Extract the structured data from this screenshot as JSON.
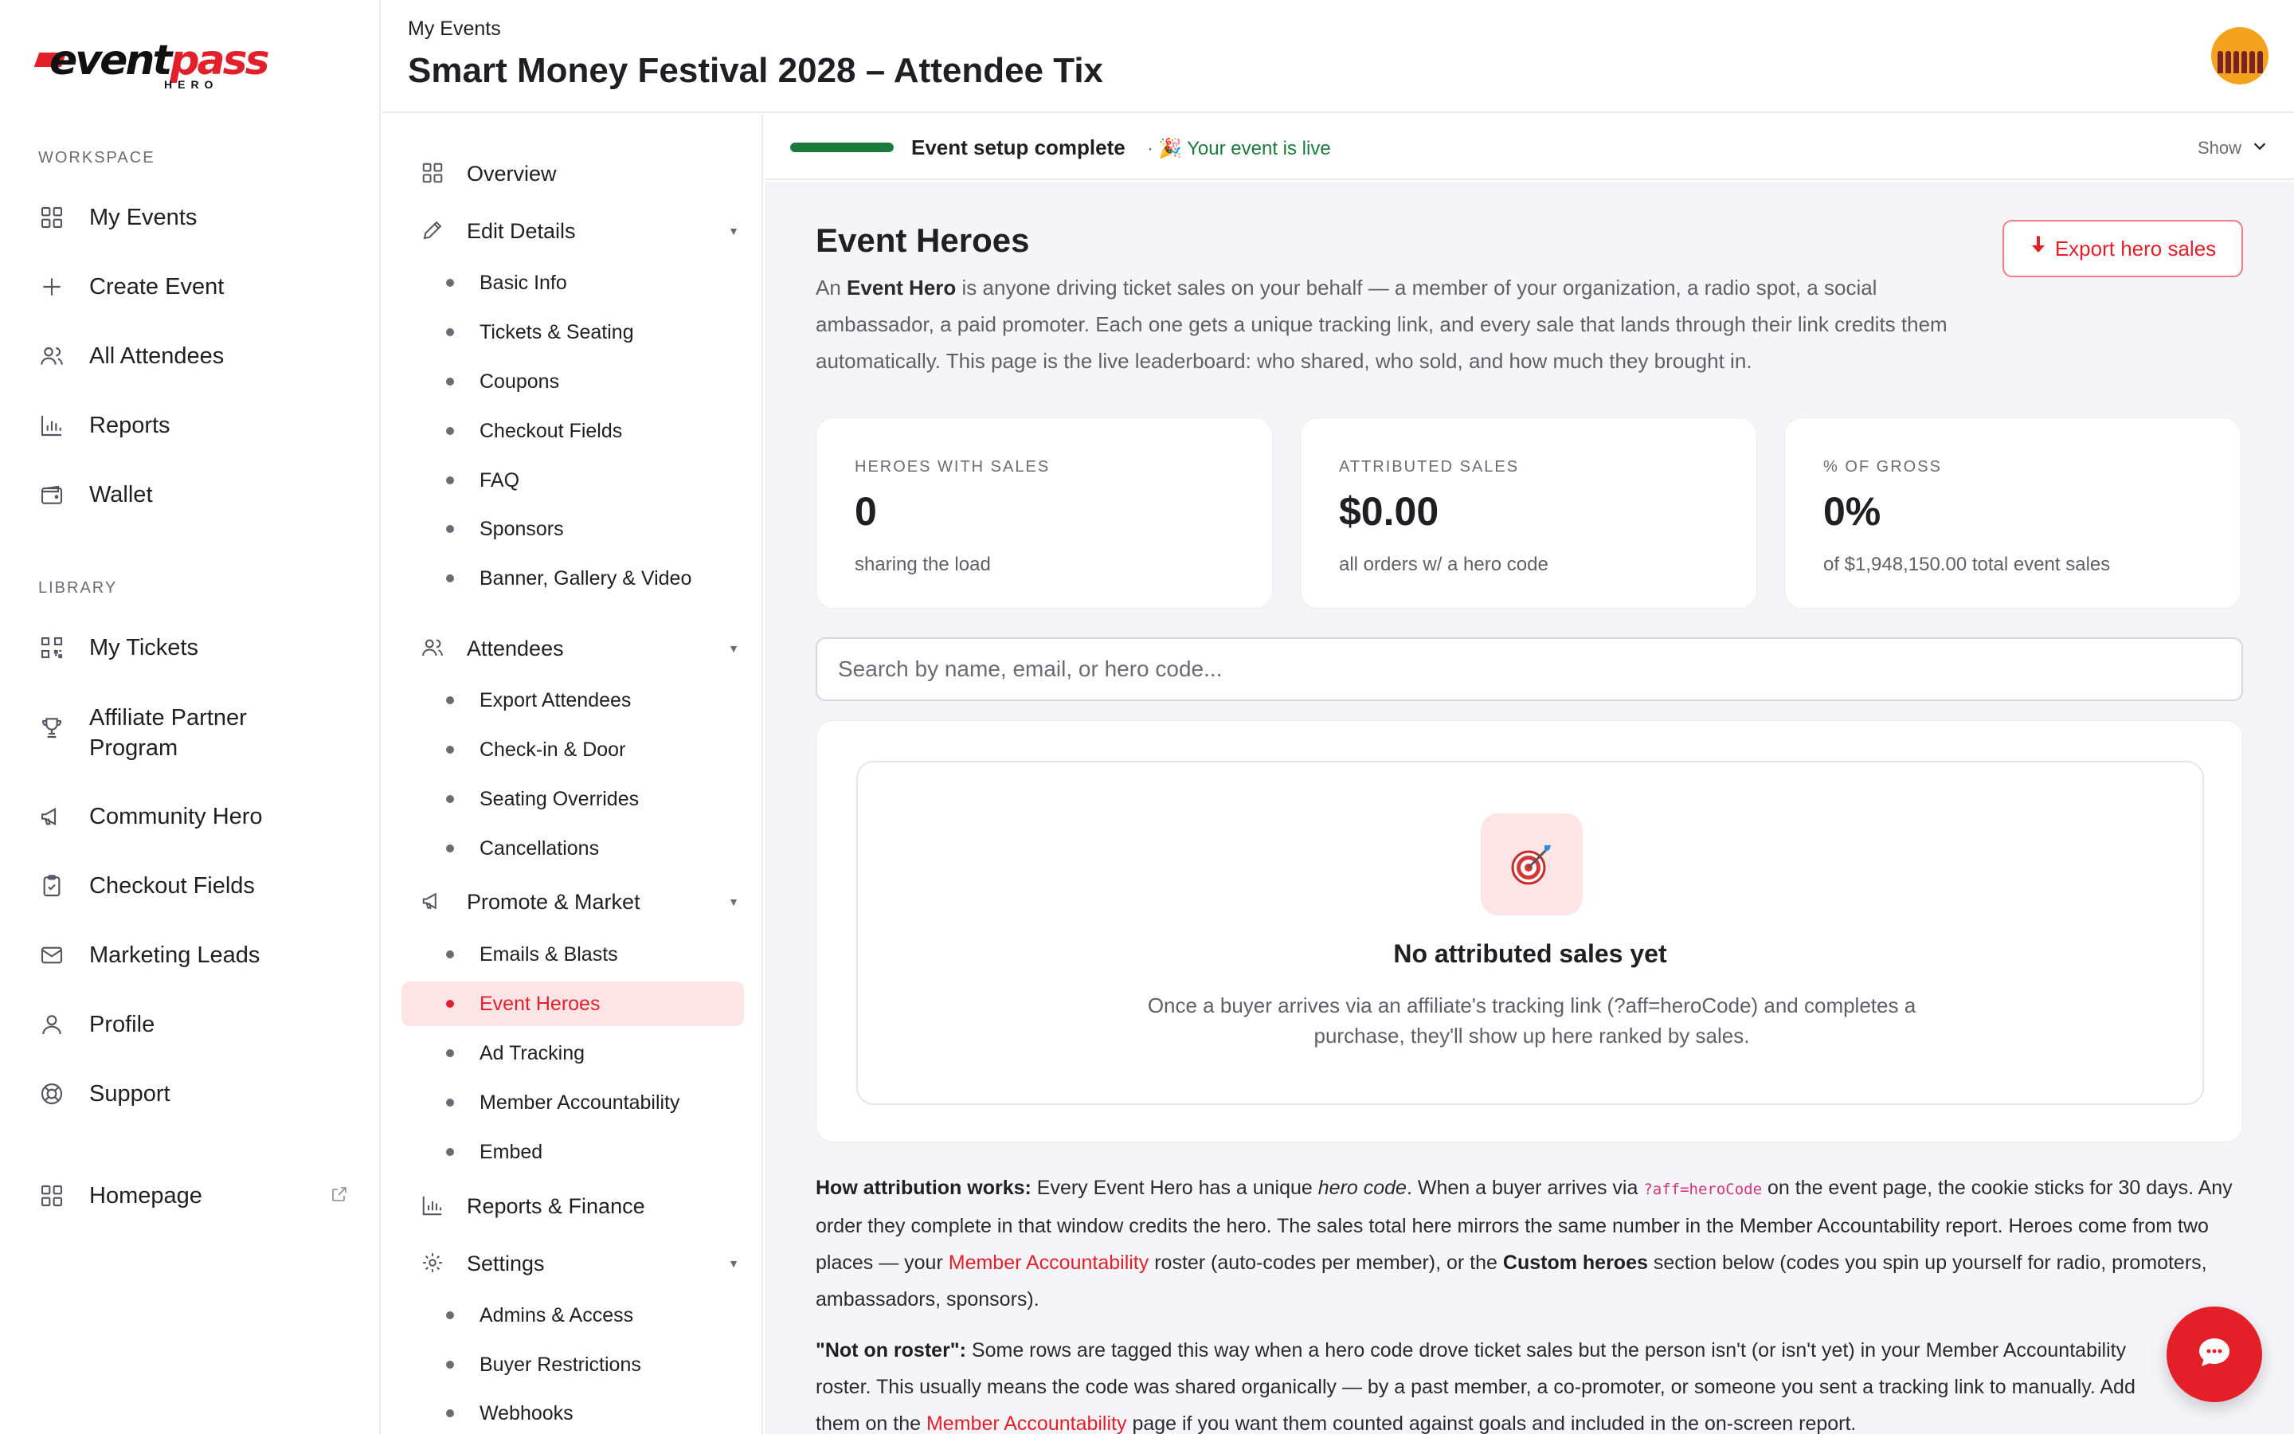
{
  "brand": {
    "logo_event": "event",
    "logo_pass": "pass",
    "logo_sub": "HERO",
    "accent": "#e3202a",
    "success": "#1a7a3c"
  },
  "sidebar": {
    "workspace_label": "WORKSPACE",
    "workspace_items": [
      {
        "label": "My Events",
        "icon": "grid-icon"
      },
      {
        "label": "Create Event",
        "icon": "plus-icon"
      },
      {
        "label": "All Attendees",
        "icon": "users-icon"
      },
      {
        "label": "Reports",
        "icon": "bar-chart-icon"
      },
      {
        "label": "Wallet",
        "icon": "wallet-icon"
      }
    ],
    "library_label": "LIBRARY",
    "library_items": [
      {
        "label": "My Tickets",
        "icon": "qr-icon"
      },
      {
        "label": "Affiliate Partner Program",
        "icon": "trophy-icon"
      },
      {
        "label": "Community Hero",
        "icon": "megaphone-icon"
      },
      {
        "label": "Checkout Fields",
        "icon": "clipboard-check-icon"
      },
      {
        "label": "Marketing Leads",
        "icon": "mail-icon"
      },
      {
        "label": "Profile",
        "icon": "user-icon"
      },
      {
        "label": "Support",
        "icon": "lifebuoy-icon"
      }
    ],
    "homepage": {
      "label": "Homepage",
      "icon": "grid-icon"
    }
  },
  "header": {
    "breadcrumb": "My Events",
    "title": "Smart Money Festival 2028 – Attendee Tix"
  },
  "subnav": {
    "overview": "Overview",
    "edit_details": {
      "label": "Edit Details",
      "items": [
        "Basic Info",
        "Tickets & Seating",
        "Coupons",
        "Checkout Fields",
        "FAQ",
        "Sponsors",
        "Banner, Gallery & Video"
      ]
    },
    "attendees": {
      "label": "Attendees",
      "items": [
        "Export Attendees",
        "Check-in & Door",
        "Seating Overrides",
        "Cancellations"
      ]
    },
    "promote": {
      "label": "Promote & Market",
      "items": [
        "Emails & Blasts",
        "Event Heroes",
        "Ad Tracking",
        "Member Accountability",
        "Embed"
      ]
    },
    "reports_finance": "Reports & Finance",
    "settings": {
      "label": "Settings",
      "items": [
        "Admins & Access",
        "Buyer Restrictions",
        "Webhooks"
      ]
    },
    "active_item": "Event Heroes"
  },
  "setup": {
    "progress": 1.0,
    "status": "Event setup complete",
    "live_sep": "·",
    "live_emoji": "🎉",
    "live": "Your event is live",
    "show": "Show"
  },
  "main": {
    "heading": "Event Heroes",
    "intro_a": "An ",
    "intro_b": "Event Hero",
    "intro_c": " is anyone driving ticket sales on your behalf — a member of your organization, a radio spot, a social ambassador, a paid promoter. Each one gets a unique tracking link, and every sale that lands through their link credits them automatically. This page is the live leaderboard: who shared, who sold, and how much they brought in.",
    "export_label": "Export hero sales",
    "stats": [
      {
        "label": "HEROES WITH SALES",
        "value": "0",
        "sub": "sharing the load"
      },
      {
        "label": "ATTRIBUTED SALES",
        "value": "$0.00",
        "sub": "all orders w/ a hero code"
      },
      {
        "label": "% OF GROSS",
        "value": "0%",
        "sub": "of $1,948,150.00 total event sales"
      }
    ],
    "search_placeholder": "Search by name, email, or hero code...",
    "empty_title": "No attributed sales yet",
    "empty_desc": "Once a buyer arrives via an affiliate's tracking link (?aff=heroCode) and completes a purchase, they'll show up here ranked by sales.",
    "note1": {
      "b1": "How attribution works:",
      "t1": " Every Event Hero has a unique ",
      "i1": "hero code",
      "t2": ". When a buyer arrives via ",
      "code": "?aff=heroCode",
      "t3": " on the event page, the cookie sticks for 30 days. Any order they complete in that window credits the hero. The sales total here mirrors the same number in the Member Accountability report. Heroes come from two places — your ",
      "link1": "Member Accountability",
      "t4": " roster (auto-codes per member), or the ",
      "b2": "Custom heroes",
      "t5": " section below (codes you spin up yourself for radio, promoters, ambassadors, sponsors)."
    },
    "note2": {
      "b1": "\"Not on roster\":",
      "t1": " Some rows are tagged this way when a hero code drove ticket sales but the person isn't (or isn't yet) in your Member Accountability roster. This usually means the code was shared organically — by a past member, a co-promoter, or someone you sent a tracking link to manually. Add them on the ",
      "link1": "Member Accountability",
      "t2": " page if you want them counted against goals and included in the on-screen report."
    }
  }
}
